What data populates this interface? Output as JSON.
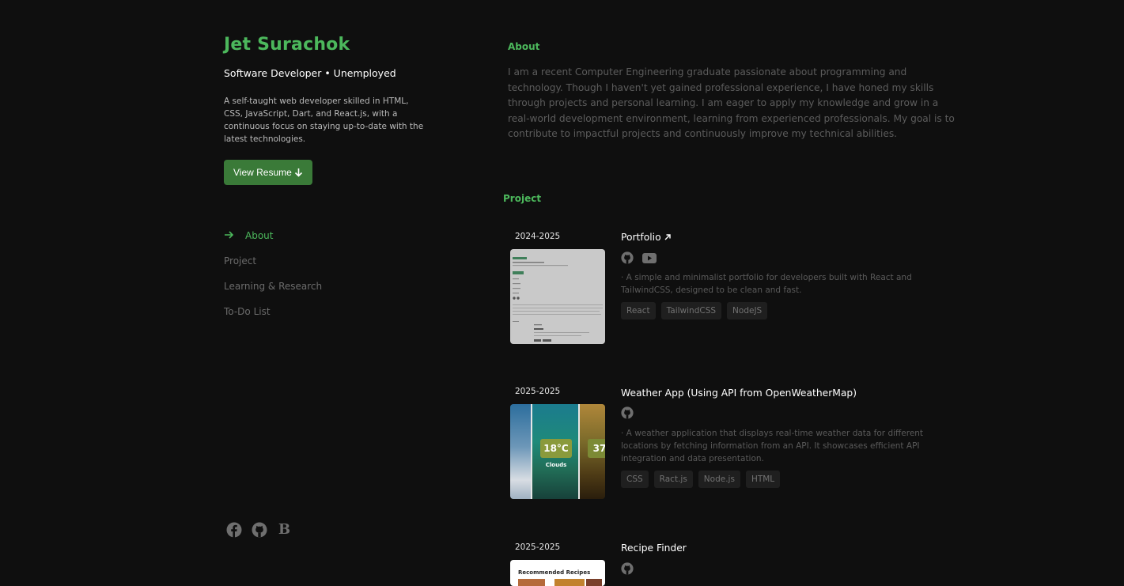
{
  "profile": {
    "name": "Jet Surachok",
    "role": "Software Developer • Unemployed",
    "bio": "A self-taught web developer skilled in HTML, CSS, JavaScript, Dart, and React.js, with a continuous focus on staying up-to-date with the latest technologies.",
    "resume_label": "View Resume"
  },
  "nav": {
    "items": [
      {
        "label": "About",
        "active": true
      },
      {
        "label": "Project",
        "active": false
      },
      {
        "label": "Learning & Research",
        "active": false
      },
      {
        "label": "To-Do List",
        "active": false
      }
    ]
  },
  "socials": [
    "facebook-icon",
    "github-icon",
    "blog-b-icon"
  ],
  "about": {
    "title": "About",
    "text": "I am a recent Computer Engineering graduate passionate about programming and technology. Though I haven't yet gained professional experience, I have honed my skills through projects and personal learning. I am eager to apply my knowledge and grow in a real-world development environment, learning from experienced professionals. My goal is to contribute to impactful projects and continuously improve my technical abilities."
  },
  "projects_section": {
    "title": "Project",
    "items": [
      {
        "year": "2024-2025",
        "title": "Portfolio",
        "link_icon": "external-link-icon",
        "icons": [
          "github-icon",
          "youtube-icon"
        ],
        "description": "· A simple and minimalist portfolio for developers built with React and TailwindCSS, designed to be clean and fast.",
        "tags": [
          "React",
          "TailwindCSS",
          "NodeJS"
        ]
      },
      {
        "year": "2025-2025",
        "title": "Weather App (Using API from OpenWeatherMap)",
        "icons": [
          "github-icon"
        ],
        "description": "· A weather application that displays real-time weather data for different locations by fetching information from an API. It showcases efficient API integration and data presentation.",
        "tags": [
          "CSS",
          "Ract.js",
          "Node.js",
          "HTML"
        ],
        "thumbnail": {
          "temp_main": "18°C",
          "cond_main": "Clouds",
          "temp_side": "37"
        }
      },
      {
        "year": "2025-2025",
        "title": "Recipe Finder",
        "icons": [
          "github-icon"
        ],
        "thumbnail": {
          "heading": "Recommended Recipes"
        }
      }
    ]
  },
  "colors": {
    "accent": "#4cb85c",
    "button": "#3a7a38",
    "background": "#0f0f0f"
  }
}
